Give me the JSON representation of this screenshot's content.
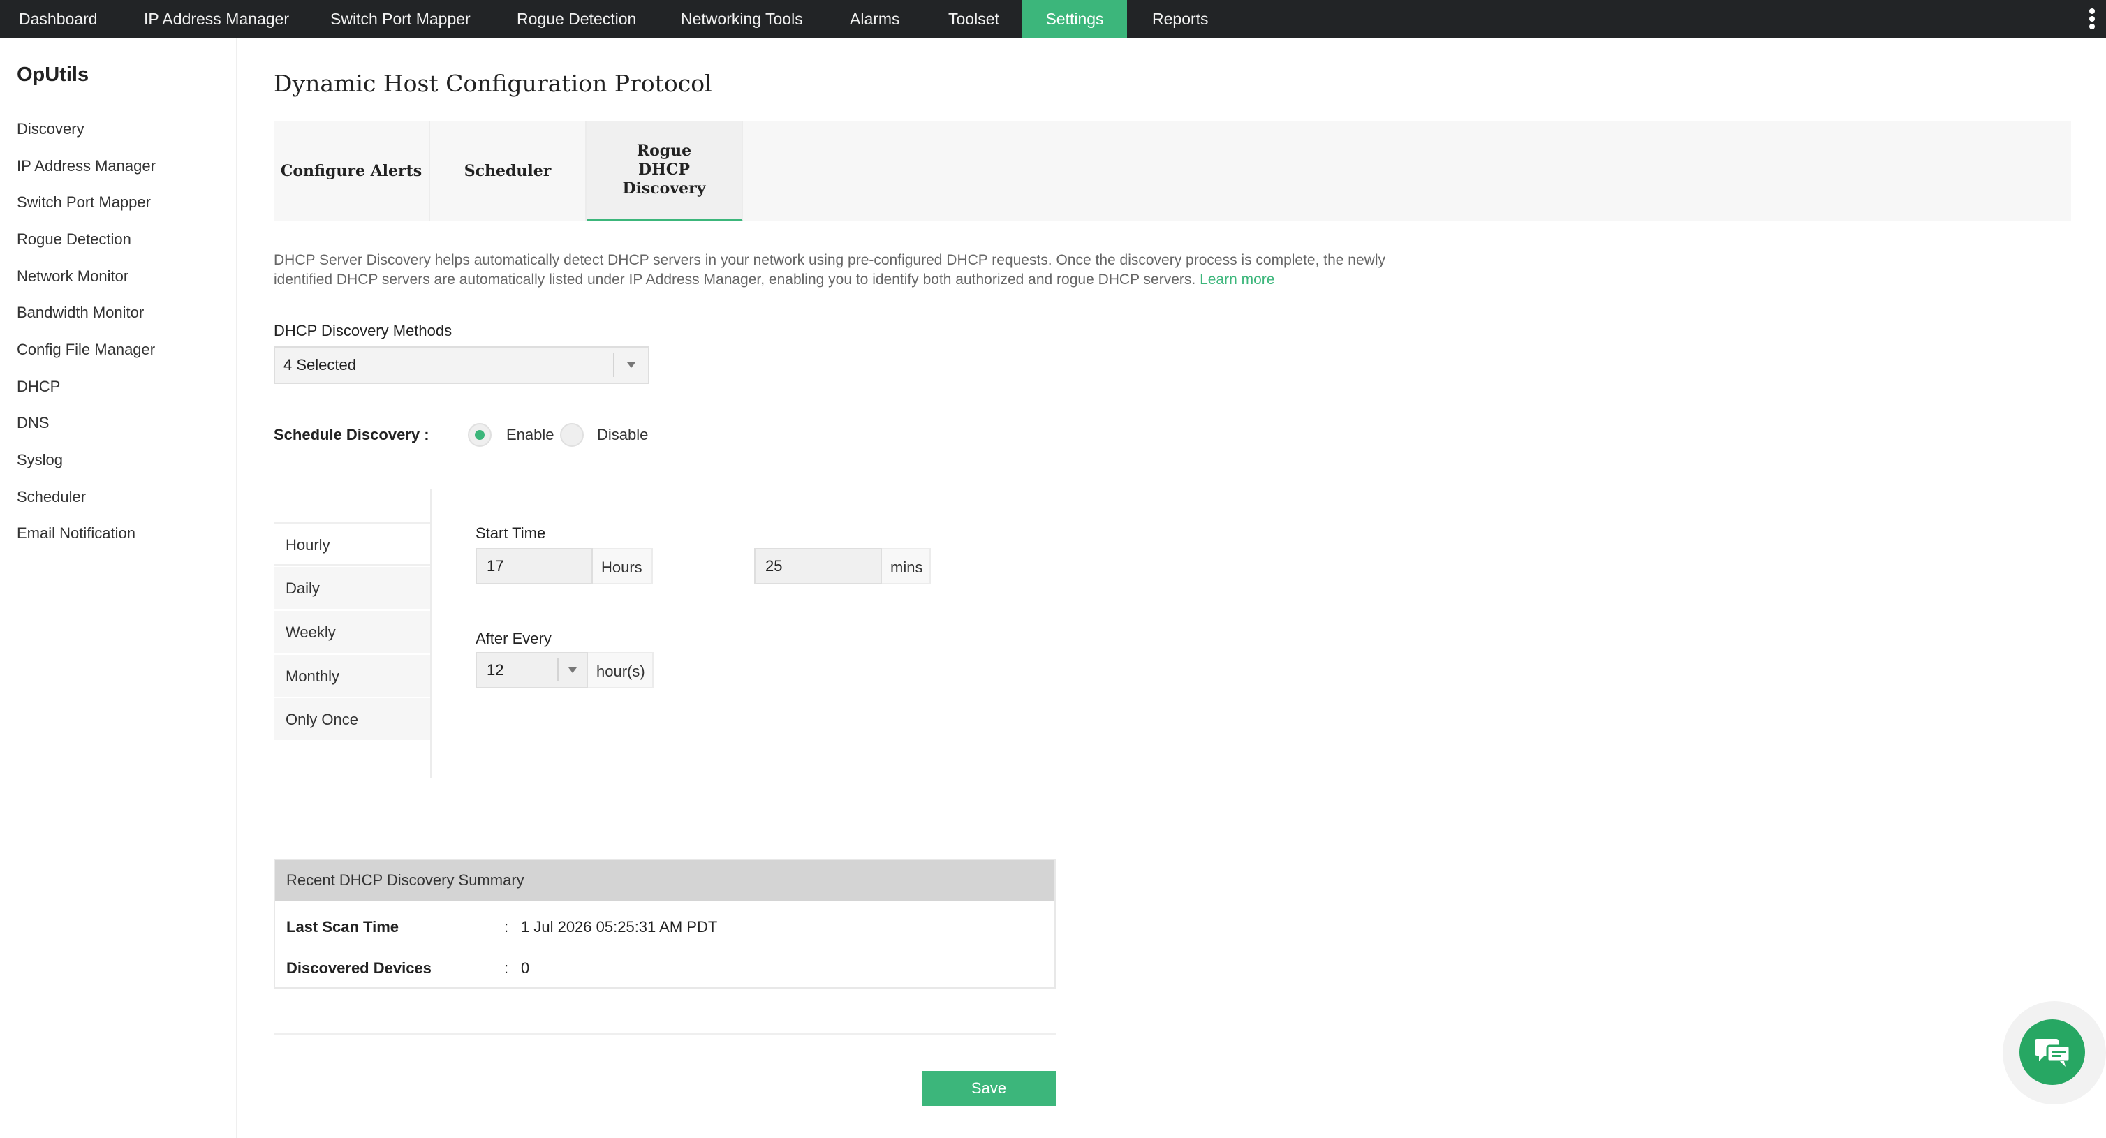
{
  "topnav": {
    "items": [
      "Dashboard",
      "IP Address Manager",
      "Switch Port Mapper",
      "Rogue Detection",
      "Networking Tools",
      "Alarms",
      "Toolset",
      "Settings",
      "Reports"
    ],
    "active": "Settings",
    "accent_color": "#3cb67b"
  },
  "sidebar": {
    "brand": "OpUtils",
    "items": [
      "Discovery",
      "IP Address Manager",
      "Switch Port Mapper",
      "Rogue Detection",
      "Network Monitor",
      "Bandwidth Monitor",
      "Config File Manager",
      "DHCP",
      "DNS",
      "Syslog",
      "Scheduler",
      "Email Notification"
    ]
  },
  "page": {
    "title": "Dynamic Host Configuration Protocol",
    "tabs": [
      "Configure Alerts",
      "Scheduler",
      "Rogue DHCP Discovery"
    ],
    "active_tab": "Rogue DHCP Discovery",
    "description": "DHCP Server Discovery helps automatically detect DHCP servers in your network using pre-configured DHCP requests. Once the discovery process is complete, the newly identified DHCP servers are automatically listed under IP Address Manager, enabling you to identify both authorized and rogue DHCP servers.",
    "learn_more": "Learn more"
  },
  "discovery_methods": {
    "label": "DHCP Discovery Methods",
    "value": "4 Selected"
  },
  "schedule": {
    "label": "Schedule Discovery :",
    "enable_label": "Enable",
    "disable_label": "Disable",
    "selected": "Enable",
    "frequencies": [
      "Hourly",
      "Daily",
      "Weekly",
      "Monthly",
      "Only Once"
    ],
    "active_frequency": "Hourly",
    "start_time_label": "Start Time",
    "hours_value": "17",
    "hours_unit": "Hours",
    "mins_value": "25",
    "mins_unit": "mins",
    "after_every_label": "After Every",
    "after_every_value": "12",
    "after_every_unit": "hour(s)"
  },
  "summary": {
    "title": "Recent DHCP Discovery Summary",
    "rows": [
      {
        "label": "Last Scan Time",
        "value": "1 Jul 2026 05:25:31 AM PDT"
      },
      {
        "label": "Discovered Devices",
        "value": "0"
      }
    ]
  },
  "actions": {
    "save": "Save"
  },
  "icons": {
    "menu": "kebab-menu-icon",
    "dropdown": "chevron-down-icon",
    "chat": "chat-icon"
  }
}
